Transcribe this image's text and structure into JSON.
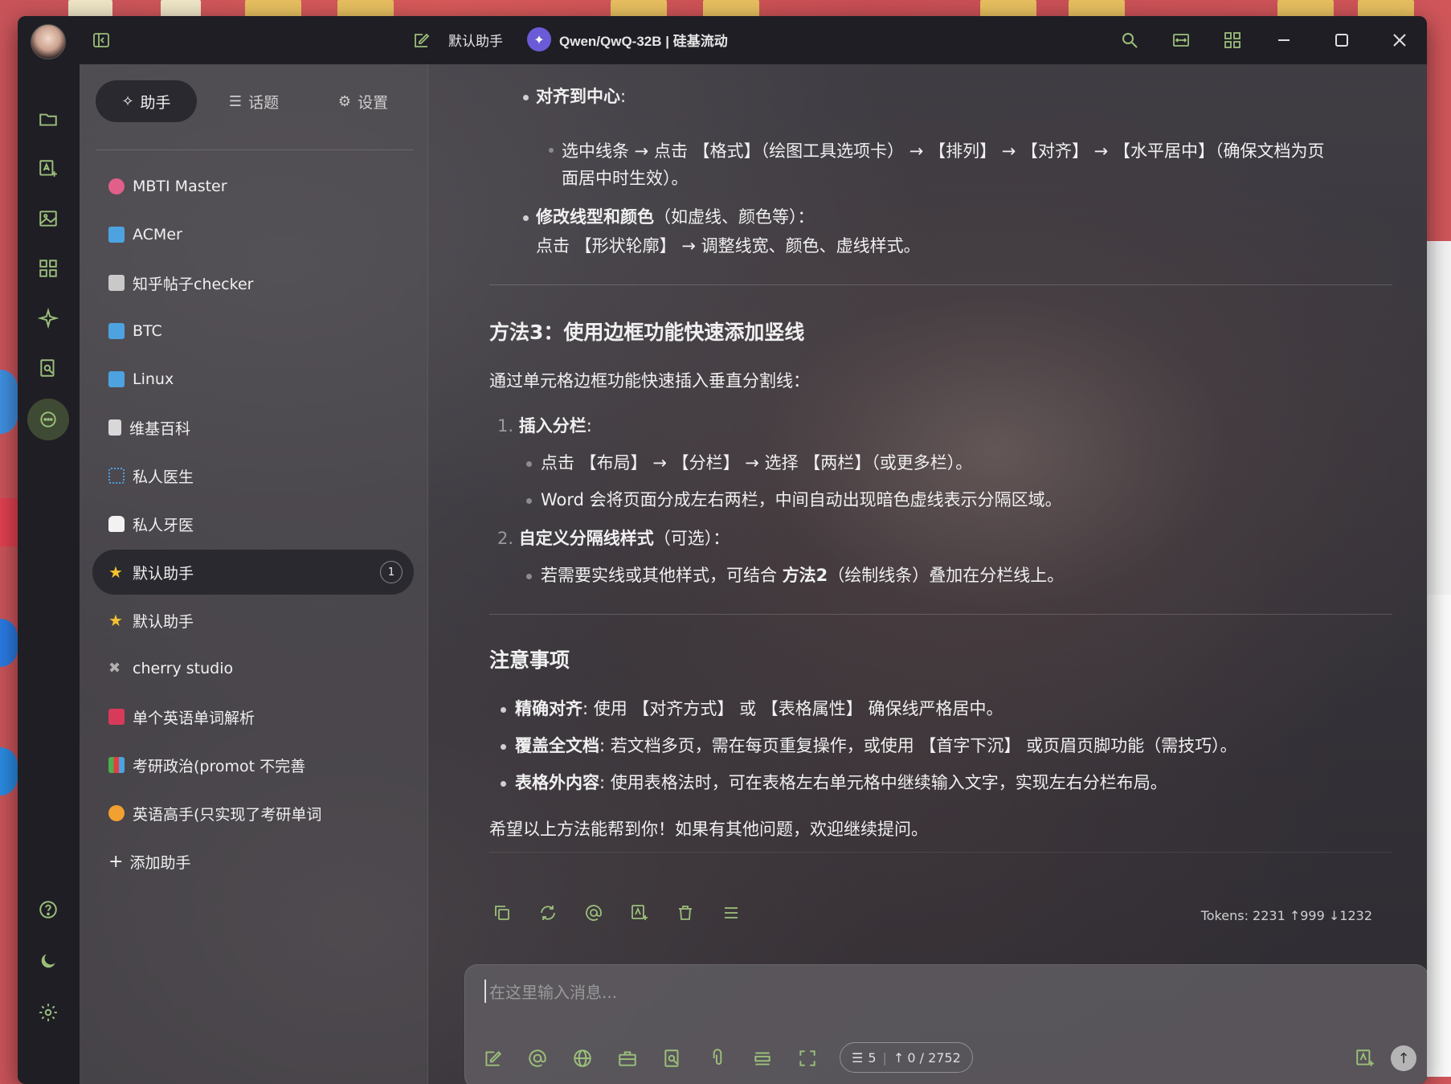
{
  "window": {
    "title": "默认助手",
    "model": "Qwen/QwQ-32B | 硅基流动"
  },
  "tabs": [
    {
      "label": "助手",
      "icon": "sparkle-icon"
    },
    {
      "label": "话题",
      "icon": "list-icon"
    },
    {
      "label": "设置",
      "icon": "gear-icon"
    }
  ],
  "assistants": [
    {
      "label": "MBTI Master",
      "color": "#e0608a",
      "active": false,
      "badge": ""
    },
    {
      "label": "ACMer",
      "color": "#4da3e0",
      "active": false,
      "badge": ""
    },
    {
      "label": "知乎帖子checker",
      "color": "#c9c9c9",
      "active": false,
      "badge": ""
    },
    {
      "label": "BTC",
      "color": "#4da3e0",
      "active": false,
      "badge": ""
    },
    {
      "label": "Linux",
      "color": "#4da3e0",
      "active": false,
      "badge": ""
    },
    {
      "label": "维基百科",
      "color": "#d8d8d8",
      "active": false,
      "badge": ""
    },
    {
      "label": "私人医生",
      "color": "#4da3e0",
      "active": false,
      "badge": ""
    },
    {
      "label": "私人牙医",
      "color": "#f2f2f2",
      "active": false,
      "badge": ""
    },
    {
      "label": "默认助手",
      "color": "#f2c230",
      "active": true,
      "badge": "1"
    },
    {
      "label": "默认助手",
      "color": "#f2c230",
      "active": false,
      "badge": ""
    },
    {
      "label": "cherry studio",
      "color": "#b0b0b0",
      "active": false,
      "badge": ""
    },
    {
      "label": "单个英语单词解析",
      "color": "#d83a5a",
      "active": false,
      "badge": ""
    },
    {
      "label": "考研政治(promot 不完善",
      "color": "#4caf50",
      "active": false,
      "badge": ""
    },
    {
      "label": "英语高手(只实现了考研单词",
      "color": "#f2a030",
      "active": false,
      "badge": ""
    }
  ],
  "add_assistant": "添加助手",
  "message": {
    "l1_label": "对齐到中心",
    "l1_colon": ":",
    "l2a": "选中线条 → 点击 【格式】（绘图工具选项卡） → 【排列】 → 【对齐】 → 【水平居中】（确保文档为页",
    "l2b": "面居中时生效）。",
    "l3_label": "修改线型和颜色",
    "l3_rest": "（如虚线、颜色等）：",
    "l4": "点击 【形状轮廓】 → 调整线宽、颜色、虚线样式。",
    "h_method3": "方法3：使用边框功能快速添加竖线",
    "p_method3": "通过单元格边框功能快速插入垂直分割线：",
    "n1": "1.",
    "n1_label": "插入分栏",
    "n1_colon": ":",
    "n1_a": "点击 【布局】 → 【分栏】 → 选择 【两栏】（或更多栏）。",
    "n1_b": "Word 会将页面分成左右两栏，中间自动出现暗色虚线表示分隔区域。",
    "n2": "2.",
    "n2_label": "自定义分隔线样式",
    "n2_rest": "（可选）：",
    "n2_a_pre": "若需要实线或其他样式，可结合 ",
    "n2_a_bold": "方法2",
    "n2_a_post": "（绘制线条）叠加在分栏线上。",
    "h_notes": "注意事项",
    "note1_label": "精确对齐",
    "note1_rest": ": 使用 【对齐方式】 或 【表格属性】 确保线严格居中。",
    "note2_label": "覆盖全文档",
    "note2_rest": ": 若文档多页，需在每页重复操作，或使用 【首字下沉】 或页眉页脚功能（需技巧）。",
    "note3_label": "表格外内容",
    "note3_rest": ": 使用表格法时，可在表格左右单元格中继续输入文字，实现左右分栏布局。",
    "closing": "希望以上方法能帮到你！如果有其他问题，欢迎继续提问。",
    "tokens": "Tokens: 2231 ↑999 ↓1232"
  },
  "input": {
    "placeholder": "在这里输入消息...",
    "context_count": "5",
    "token_count": "0 / 2752"
  },
  "colors": {
    "accent": "#9bbf7a",
    "window_bg": "#23222a"
  }
}
